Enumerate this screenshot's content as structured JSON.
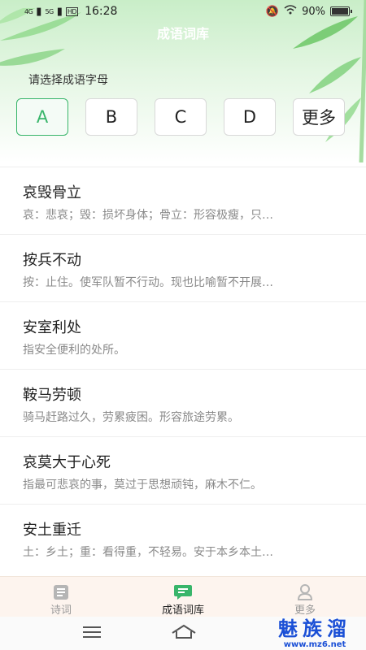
{
  "status": {
    "signal1": "4G",
    "signal2": "5G",
    "hd": "HD",
    "time": "16:28",
    "battery_percent": "90%",
    "battery_level": 0.9
  },
  "header": {
    "title": "成语词库"
  },
  "selector": {
    "prompt": "请选择成语字母",
    "letters": [
      "A",
      "B",
      "C",
      "D",
      "更多"
    ],
    "active_index": 0
  },
  "idioms": [
    {
      "name": "哀毁骨立",
      "desc": "哀：悲哀；毁：损坏身体；骨立：形容极瘦，只…"
    },
    {
      "name": "按兵不动",
      "desc": "按：止住。使军队暂不行动。现也比喻暂不开展…"
    },
    {
      "name": "安室利处",
      "desc": "指安全便利的处所。"
    },
    {
      "name": "鞍马劳顿",
      "desc": "骑马赶路过久，劳累疲困。形容旅途劳累。"
    },
    {
      "name": "哀莫大于心死",
      "desc": "指最可悲哀的事，莫过于思想顽钝，麻木不仁。"
    },
    {
      "name": "安土重迁",
      "desc": "土：乡土；重：看得重，不轻易。安于本乡本土…"
    }
  ],
  "tabbar": {
    "tabs": [
      {
        "label": "诗词",
        "icon": "book-icon"
      },
      {
        "label": "成语词库",
        "icon": "chat-icon"
      },
      {
        "label": "更多",
        "icon": "person-icon"
      }
    ],
    "active_index": 1
  },
  "watermark": {
    "big": "魅族溜",
    "small": "www.mz6.net"
  },
  "colors": {
    "accent": "#38b56a",
    "watermark": "#1a4fd6",
    "tabbar_bg": "#fdf4ee"
  }
}
